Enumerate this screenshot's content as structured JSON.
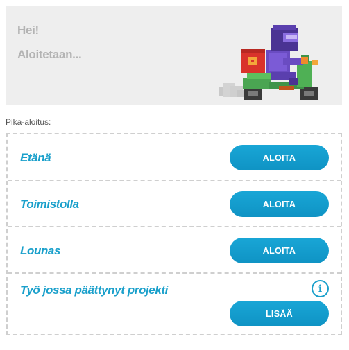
{
  "hero": {
    "greeting": "Hei!",
    "subtitle": "Aloitetaan...",
    "illustration": "delivery-scooter-rider-illustration"
  },
  "quickstart": {
    "label": "Pika-aloitus:",
    "items": [
      {
        "title": "Etänä",
        "button_label": "ALOITA"
      },
      {
        "title": "Toimistolla",
        "button_label": "ALOITA"
      },
      {
        "title": "Lounas",
        "button_label": "ALOITA"
      },
      {
        "title": "Työ jossa päättynyt projekti",
        "button_label": "LISÄÄ",
        "icon": "info-icon"
      }
    ]
  },
  "colors": {
    "accent": "#1aa0cb",
    "button": "#12a0d2",
    "hero_bg": "#eeeeee",
    "hero_text": "#b3b3b3",
    "divider": "#cfcfcf"
  }
}
